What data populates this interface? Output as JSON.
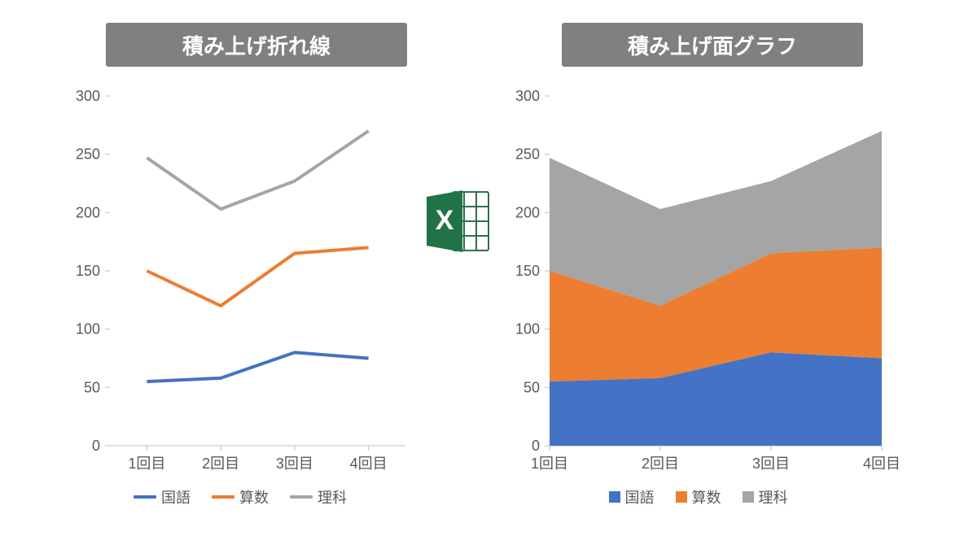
{
  "titles": {
    "left": "積み上げ折れ線",
    "right": "積み上げ面グラフ"
  },
  "colors": {
    "s1": "#4472C4",
    "s2": "#ED7D31",
    "s3": "#A5A5A5"
  },
  "chart_data": [
    {
      "type": "line",
      "stacked": true,
      "title": "積み上げ折れ線",
      "categories": [
        "1回目",
        "2回目",
        "3回目",
        "4回目"
      ],
      "series": [
        {
          "name": "国語",
          "values": [
            55,
            58,
            80,
            75
          ]
        },
        {
          "name": "算数",
          "values": [
            95,
            62,
            85,
            95
          ]
        },
        {
          "name": "理科",
          "values": [
            97,
            83,
            62,
            100
          ]
        }
      ],
      "cumulative": [
        [
          55,
          58,
          80,
          75
        ],
        [
          150,
          120,
          165,
          170
        ],
        [
          247,
          203,
          227,
          270
        ]
      ],
      "yticks": [
        0,
        50,
        100,
        150,
        200,
        250,
        300
      ],
      "ylim": [
        0,
        300
      ]
    },
    {
      "type": "area",
      "stacked": true,
      "title": "積み上げ面グラフ",
      "categories": [
        "1回目",
        "2回目",
        "3回目",
        "4回目"
      ],
      "series": [
        {
          "name": "国語",
          "values": [
            55,
            58,
            80,
            75
          ]
        },
        {
          "name": "算数",
          "values": [
            95,
            62,
            85,
            95
          ]
        },
        {
          "name": "理科",
          "values": [
            97,
            83,
            62,
            100
          ]
        }
      ],
      "cumulative": [
        [
          55,
          58,
          80,
          75
        ],
        [
          150,
          120,
          165,
          170
        ],
        [
          247,
          203,
          227,
          270
        ]
      ],
      "yticks": [
        0,
        50,
        100,
        150,
        200,
        250,
        300
      ],
      "ylim": [
        0,
        300
      ]
    }
  ],
  "legend": {
    "s1": "国語",
    "s2": "算数",
    "s3": "理科"
  }
}
